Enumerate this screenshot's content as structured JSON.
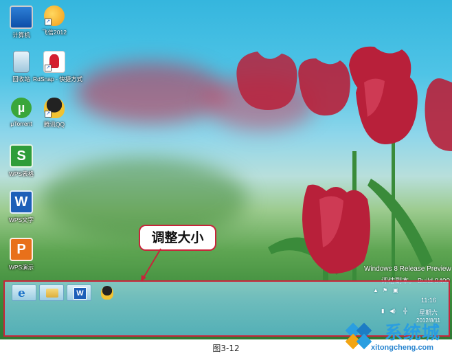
{
  "desktop": {
    "icons": [
      {
        "name": "computer-icon",
        "label": "计算机"
      },
      {
        "name": "feixin-icon",
        "label": "飞信2012"
      },
      {
        "name": "recycle-bin-icon",
        "label": "回收站"
      },
      {
        "name": "redsnap-icon",
        "label": "RdSnap - 快捷方式"
      },
      {
        "name": "utorrent-icon",
        "label": "μTorrent"
      },
      {
        "name": "qq-icon",
        "label": "腾讯QQ"
      },
      {
        "name": "wps-spreadsheet-icon",
        "label": "WPS表格"
      },
      {
        "name": "wps-writer-icon",
        "label": "WPS文字"
      },
      {
        "name": "wps-presentation-icon",
        "label": "WPS演示"
      }
    ],
    "watermark_preview": "Windows 8 Release Preview",
    "watermark_build": "评估副本。 Build 8400"
  },
  "taskbar": {
    "pinned": [
      {
        "name": "internet-explorer-icon"
      },
      {
        "name": "file-explorer-icon"
      },
      {
        "name": "word-icon"
      },
      {
        "name": "qq-taskbar-icon"
      }
    ],
    "tray": {
      "time": "11:16",
      "weekday": "星期六",
      "date": "2012/8/11"
    }
  },
  "callout": {
    "text": "调整大小"
  },
  "caption": "图3-12",
  "logo": {
    "name": "系统城",
    "url": "xitongcheng.com"
  },
  "colors": {
    "highlight": "#c8243a",
    "sky": "#35b6de",
    "tulip": "#c0203a",
    "logo": "#2a9ee0"
  }
}
